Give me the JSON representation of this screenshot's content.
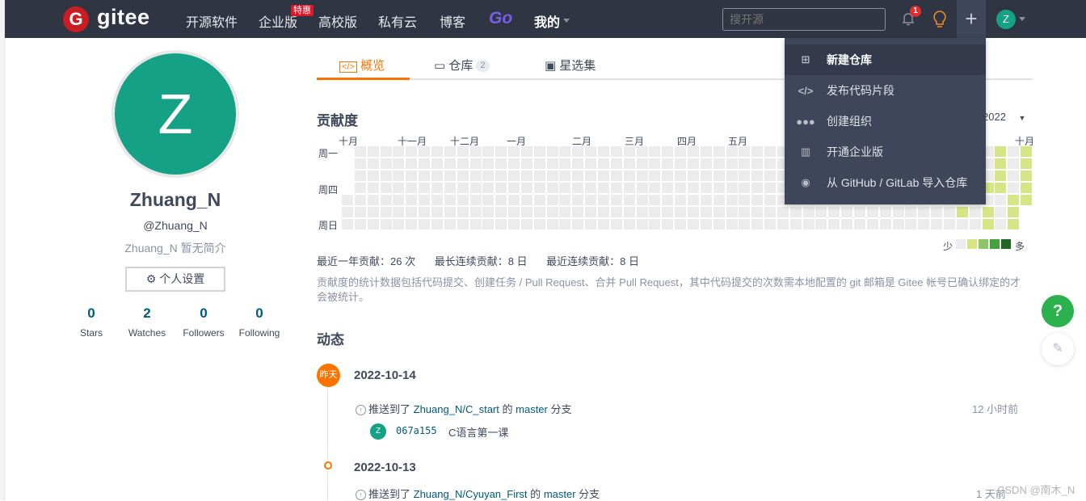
{
  "nav": {
    "logo_text": "gitee",
    "logo_letter": "G",
    "links": [
      "开源软件",
      "企业版",
      "高校版",
      "私有云",
      "博客"
    ],
    "enterprise_badge": "特惠",
    "go_label": "Go",
    "mine_label": "我的",
    "search_placeholder": "搜开源",
    "notification_count": "1",
    "plus_symbol": "+",
    "avatar_letter": "Z"
  },
  "create_menu": {
    "items": [
      {
        "label": "新建仓库",
        "icon": "plus-square-icon",
        "active": true
      },
      {
        "label": "发布代码片段",
        "icon": "code-icon"
      },
      {
        "label": "创建组织",
        "icon": "users-icon"
      },
      {
        "label": "开通企业版",
        "icon": "building-icon"
      },
      {
        "label": "从 GitHub / GitLab 导入仓库",
        "icon": "github-icon"
      }
    ]
  },
  "profile": {
    "avatar_letter": "Z",
    "name": "Zhuang_N",
    "handle": "@Zhuang_N",
    "bio": "Zhuang_N 暂无简介",
    "settings_label": "个人设置",
    "stats": [
      {
        "value": "0",
        "label": "Stars"
      },
      {
        "value": "2",
        "label": "Watches"
      },
      {
        "value": "0",
        "label": "Followers"
      },
      {
        "value": "0",
        "label": "Following"
      }
    ]
  },
  "tabs": [
    {
      "label": "概览",
      "active": true
    },
    {
      "label": "仓库",
      "count": "2"
    },
    {
      "label": "星选集"
    }
  ],
  "contributions": {
    "title": "贡献度",
    "year": "2022",
    "months": [
      "十月",
      "十一月",
      "十二月",
      "一月",
      "二月",
      "三月",
      "四月",
      "五月",
      "十月"
    ],
    "days": [
      "周一",
      "周四",
      "周日"
    ],
    "legend_less": "少",
    "legend_more": "多",
    "legend_colors": [
      "#ececec",
      "#d6e685",
      "#8cc665",
      "#44a340",
      "#1e6823"
    ],
    "active_cells": [
      [
        48,
        5,
        1
      ],
      [
        50,
        3,
        1
      ],
      [
        50,
        5,
        1
      ],
      [
        50,
        6,
        1
      ],
      [
        51,
        0,
        1
      ],
      [
        51,
        1,
        1
      ],
      [
        51,
        2,
        1
      ],
      [
        51,
        3,
        1
      ],
      [
        52,
        4,
        1
      ],
      [
        52,
        5,
        1
      ],
      [
        52,
        6,
        1
      ],
      [
        53,
        0,
        1
      ],
      [
        53,
        1,
        1
      ],
      [
        53,
        2,
        1
      ],
      [
        53,
        3,
        1
      ],
      [
        53,
        4,
        1
      ]
    ],
    "summary": [
      "最近一年贡献：26 次",
      "最长连续贡献：8 日",
      "最近连续贡献：8 日"
    ],
    "note": "贡献度的统计数据包括代码提交、创建任务 / Pull Request、合并 Pull Request，其中代码提交的次数需本地配置的 git 邮箱是 Gitee 帐号已确认绑定的才会被统计。"
  },
  "activity": {
    "title": "动态",
    "yesterday_label": "昨天",
    "groups": [
      {
        "date": "2022-10-14",
        "prefix": "推送到了",
        "repo": "Zhuang_N/C_start",
        "mid": "的",
        "branch": "master",
        "suffix": "分支",
        "time": "12 小时前",
        "commit": {
          "avatar": "Z",
          "sha": "067a155",
          "message": "C语言第一课"
        }
      },
      {
        "date": "2022-10-13",
        "prefix": "推送到了",
        "repo": "Zhuang_N/Cyuyan_First",
        "mid": "的",
        "branch": "master",
        "suffix": "分支",
        "time": "1 天前"
      }
    ]
  },
  "floating": {
    "help": "?"
  },
  "watermark": "CSDN @南木_N"
}
